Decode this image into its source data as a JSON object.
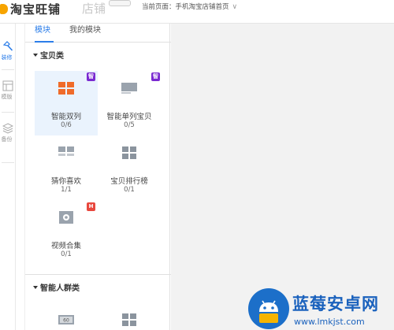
{
  "header": {
    "logo_text": "淘宝旺铺",
    "shop_label": "店铺",
    "current_page_label": "当前页面：",
    "current_page_value": "手机淘宝店铺首页"
  },
  "rail": {
    "items": [
      {
        "label": "装修",
        "icon": "hammer-icon",
        "active": true
      },
      {
        "label": "模版",
        "icon": "template-icon",
        "active": false
      },
      {
        "label": "备份",
        "icon": "layers-icon",
        "active": false
      }
    ]
  },
  "panel": {
    "tabs": [
      {
        "label": "模块",
        "active": true
      },
      {
        "label": "我的模块",
        "active": false
      }
    ],
    "sections": [
      {
        "title": "宝贝类",
        "modules": [
          {
            "name": "智能双列",
            "count": "0/6",
            "badge": "智",
            "badge_color": "#7a2ad1",
            "selected": true
          },
          {
            "name": "智能单列宝贝",
            "count": "0/5",
            "badge": "智",
            "badge_color": "#7a2ad1",
            "selected": false
          },
          {
            "name": "猜你喜欢",
            "count": "1/1",
            "badge": "",
            "selected": false
          },
          {
            "name": "宝贝排行榜",
            "count": "0/1",
            "badge": "",
            "selected": false
          },
          {
            "name": "视频合集",
            "count": "0/1",
            "badge": "H",
            "badge_color": "#e8473d",
            "selected": false
          }
        ]
      },
      {
        "title": "智能人群类",
        "modules": [
          {
            "name": "",
            "count": "",
            "thumb_label": "60"
          },
          {
            "name": "",
            "count": ""
          }
        ]
      }
    ]
  },
  "watermark": {
    "title": "蓝莓安卓网",
    "url": "www.lmkjst.com"
  },
  "colors": {
    "accent": "#2b7de9",
    "selected_bg": "#eaf3fd",
    "thumb_orange": "#f06b2a",
    "thumb_gray": "#9aa3ad"
  }
}
